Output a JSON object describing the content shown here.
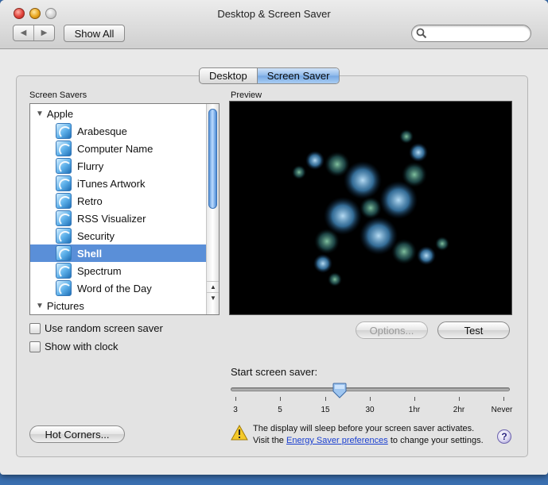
{
  "window": {
    "title": "Desktop & Screen Saver"
  },
  "toolbar": {
    "back_label": "◀",
    "forward_label": "▶",
    "show_all_label": "Show All",
    "search_placeholder": ""
  },
  "tabs": [
    {
      "label": "Desktop",
      "active": false
    },
    {
      "label": "Screen Saver",
      "active": true
    }
  ],
  "screen_savers": {
    "header": "Screen Savers",
    "groups": [
      {
        "label": "Apple",
        "items": [
          "Arabesque",
          "Computer Name",
          "Flurry",
          "iTunes Artwork",
          "Retro",
          "RSS Visualizer",
          "Security",
          "Shell",
          "Spectrum",
          "Word of the Day"
        ]
      },
      {
        "label": "Pictures",
        "items": []
      }
    ],
    "selected": "Shell"
  },
  "preview": {
    "header": "Preview"
  },
  "buttons": {
    "options": "Options...",
    "test": "Test",
    "hot_corners": "Hot Corners..."
  },
  "checkboxes": {
    "random": {
      "label": "Use random screen saver",
      "checked": false
    },
    "clock": {
      "label": "Show with clock",
      "checked": false
    }
  },
  "start_saver": {
    "label": "Start screen saver:",
    "ticks": [
      "3",
      "5",
      "15",
      "30",
      "1hr",
      "2hr",
      "Never"
    ],
    "value_fraction": 0.39
  },
  "warning": {
    "line1": "The display will sleep before your screen saver activates.",
    "line2_pre": "Visit the ",
    "link": "Energy Saver preferences",
    "line2_post": " to change your settings."
  },
  "help": {
    "label": "?"
  },
  "colors": {
    "selection": "#5a8fd8",
    "tab_active": "#8db8ea",
    "link": "#1a3fd0",
    "desktop_bg": "#3a6fb0"
  }
}
